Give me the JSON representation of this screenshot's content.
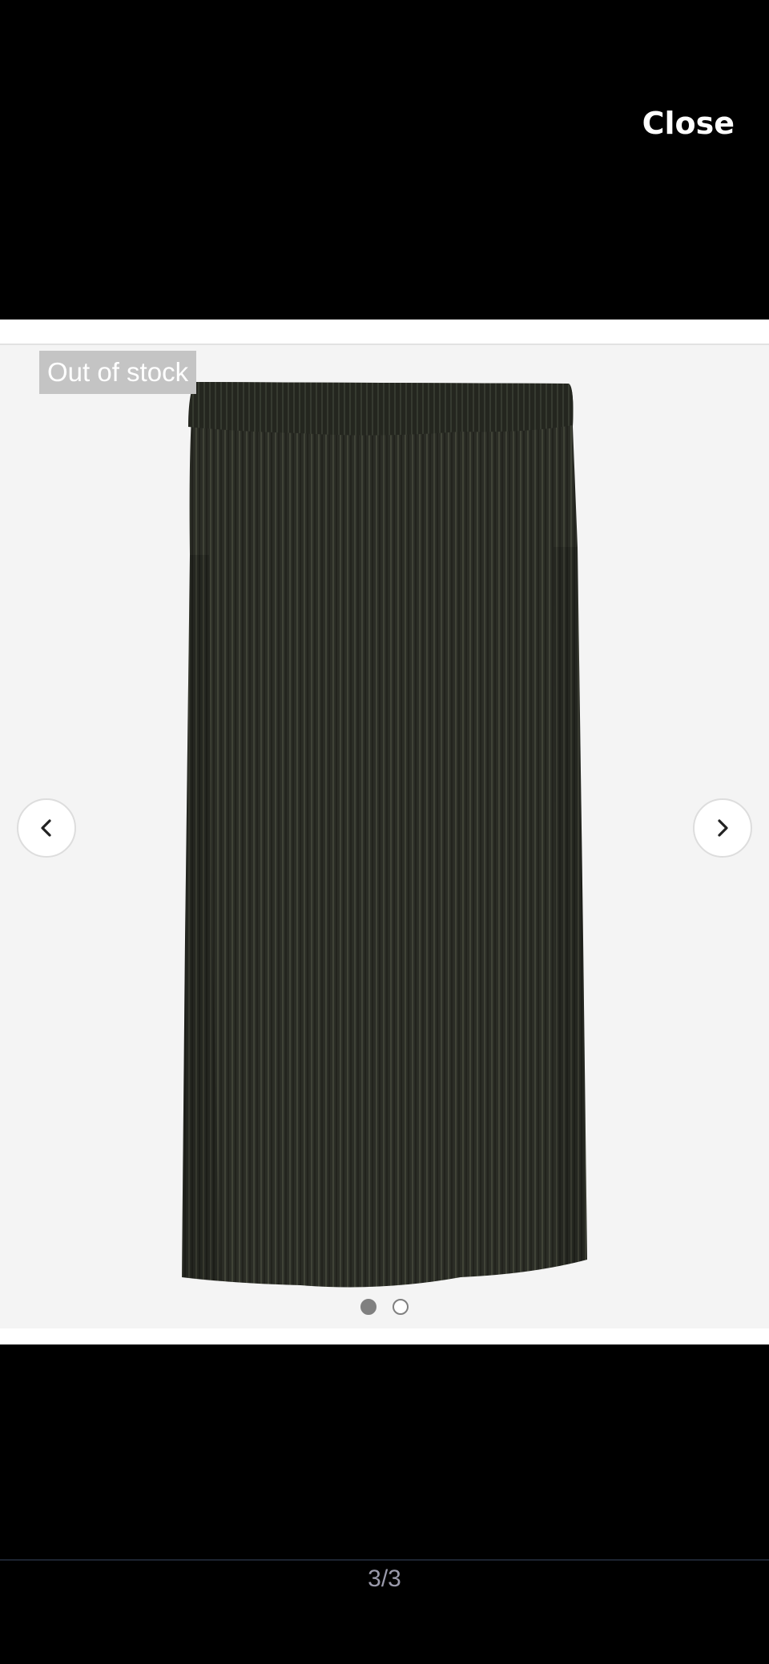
{
  "viewer": {
    "close_label": "Close",
    "page_counter": "3/3"
  },
  "product": {
    "stock_badge": "Out of stock",
    "image_alt": "Dark olive pleated midi skirt"
  },
  "carousel": {
    "prev_icon": "chevron-left-icon",
    "next_icon": "chevron-right-icon",
    "dots": [
      {
        "state": "active"
      },
      {
        "state": "inactive"
      }
    ]
  },
  "colors": {
    "background": "#000000",
    "image_bg": "#f4f4f4",
    "badge_bg": "#c4c4c4",
    "skirt": "#2a2c25",
    "counter_text": "#9a9aab"
  }
}
